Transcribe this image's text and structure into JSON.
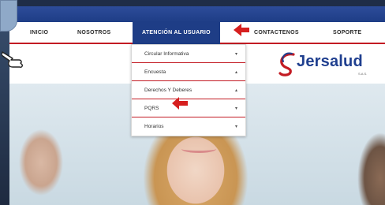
{
  "nav": {
    "items": [
      {
        "label": "INICIO"
      },
      {
        "label": "NOSOTROS"
      },
      {
        "label": "ATENCIÓN AL USUARIO"
      },
      {
        "label": "CONTACTENOS"
      },
      {
        "label": "SOPORTE"
      }
    ],
    "active_index": 2
  },
  "dropdown": {
    "items": [
      {
        "label": "Circular Informativa",
        "caret": "▾"
      },
      {
        "label": "Encuesta",
        "caret": "▴"
      },
      {
        "label": "Derechos Y Deberes",
        "caret": "▴"
      },
      {
        "label": "PQRS",
        "caret": "▾"
      },
      {
        "label": "Horarios",
        "caret": "▾"
      }
    ]
  },
  "logo": {
    "name": "Jersalud",
    "suffix": "S.A.S."
  },
  "colors": {
    "brand_blue": "#1e3d86",
    "accent_red": "#c31b23",
    "arrow_red": "#d61f1f"
  }
}
